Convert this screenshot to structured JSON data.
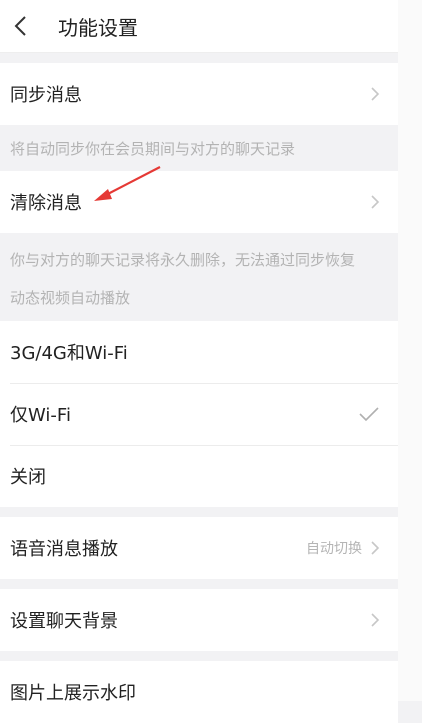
{
  "header": {
    "title": "功能设置"
  },
  "sync": {
    "label": "同步消息",
    "note": "将自动同步你在会员期间与对方的聊天记录"
  },
  "clear": {
    "label": "清除消息",
    "note": "你与对方的聊天记录将永久删除，无法通过同步恢复"
  },
  "autoplay": {
    "section_label": "动态视频自动播放",
    "options": [
      {
        "label": "3G/4G和Wi-Fi",
        "selected": false
      },
      {
        "label": "仅Wi-Fi",
        "selected": true
      },
      {
        "label": "关闭",
        "selected": false
      }
    ]
  },
  "voice": {
    "label": "语音消息播放",
    "value": "自动切换"
  },
  "background": {
    "label": "设置聊天背景"
  },
  "watermark": {
    "label": "图片上展示水印"
  },
  "colors": {
    "accent_arrow": "#e53935",
    "chevron": "#c7c7c7",
    "check": "#b0b0b0"
  },
  "icons": [
    "back-icon",
    "chevron-right-icon",
    "checkmark-icon",
    "annotation-arrow"
  ]
}
